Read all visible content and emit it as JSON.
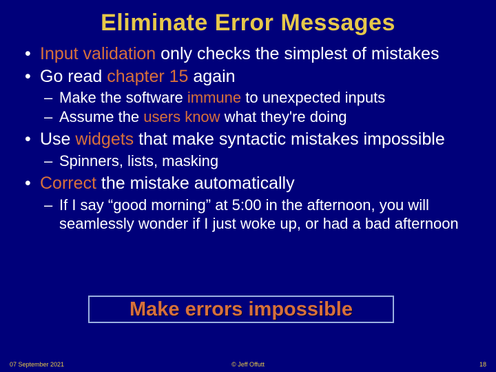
{
  "title": "Eliminate Error Messages",
  "bullets": {
    "b1_pre": "",
    "b1_hl": "Input validation",
    "b1_post": " only checks the simplest of mistakes",
    "b2_pre": "Go read ",
    "b2_hl": "chapter 15",
    "b2_post": " again",
    "b2s1_pre": "Make the software ",
    "b2s1_hl": "immune",
    "b2s1_post": " to unexpected inputs",
    "b2s2_pre": "Assume the ",
    "b2s2_hl": "users know",
    "b2s2_post": " what they're doing",
    "b3_pre": "Use ",
    "b3_hl": "widgets",
    "b3_post": " that make syntactic mistakes impossible",
    "b3s1": "Spinners, lists, masking",
    "b4_hl": "Correct",
    "b4_post": " the mistake automatically",
    "b4s1": "If I say “good morning” at 5:00 in the afternoon, you will seamlessly wonder if I just woke up, or had a bad afternoon"
  },
  "callout": "Make errors impossible",
  "footer": {
    "date": "07 September 2021",
    "author": "© Jeff Offutt",
    "page": "18"
  }
}
